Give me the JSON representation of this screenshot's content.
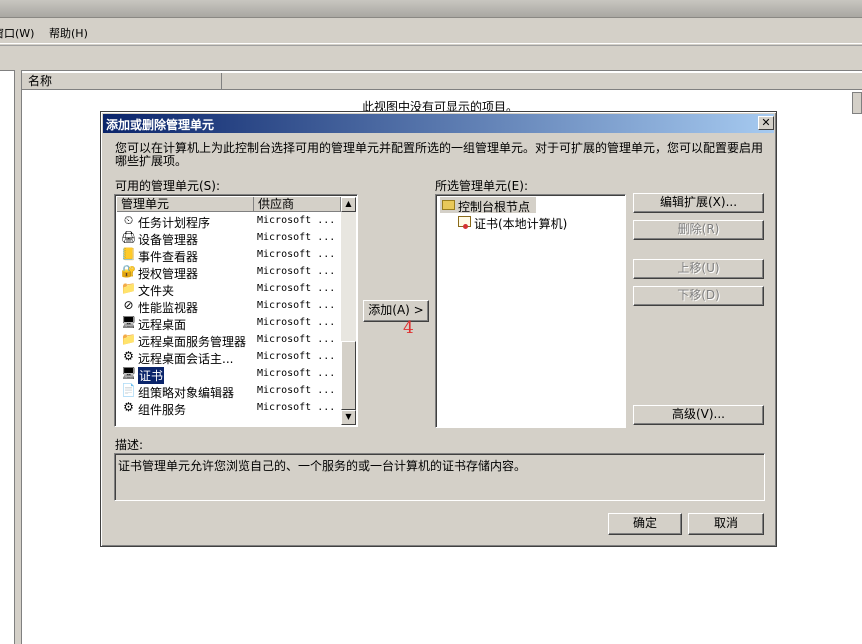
{
  "app": {
    "menu": [
      {
        "label": "窗口(W)"
      },
      {
        "label": "帮助(H)"
      }
    ],
    "list_column_name": "名称",
    "empty_message": "此视图中没有可显示的项目。"
  },
  "dialog": {
    "title": "添加或删除管理单元",
    "close_glyph": "✕",
    "intro": "您可以在计算机上为此控制台选择可用的管理单元并配置所选的一组管理单元。对于可扩展的管理单元，您可以配置要启用哪些扩展项。",
    "available_label": "可用的管理单元(S):",
    "available_columns": {
      "name": "管理单元",
      "vendor": "供应商"
    },
    "available_items": [
      {
        "name": "任务计划程序",
        "vendor": "Microsoft ...",
        "icon": "⏲",
        "icon_name": "clock-icon"
      },
      {
        "name": "设备管理器",
        "vendor": "Microsoft ...",
        "icon": "🖨",
        "icon_name": "device-manager-icon"
      },
      {
        "name": "事件查看器",
        "vendor": "Microsoft ...",
        "icon": "📒",
        "icon_name": "event-viewer-icon"
      },
      {
        "name": "授权管理器",
        "vendor": "Microsoft ...",
        "icon": "🔐",
        "icon_name": "authorization-icon"
      },
      {
        "name": "文件夹",
        "vendor": "Microsoft ...",
        "icon": "📁",
        "icon_name": "folder-icon"
      },
      {
        "name": "性能监视器",
        "vendor": "Microsoft ...",
        "icon": "⊘",
        "icon_name": "performance-monitor-icon"
      },
      {
        "name": "远程桌面",
        "vendor": "Microsoft ...",
        "icon": "🖥",
        "icon_name": "remote-desktop-icon"
      },
      {
        "name": "远程桌面服务管理器",
        "vendor": "Microsoft ...",
        "icon": "📁",
        "icon_name": "folder-icon"
      },
      {
        "name": "远程桌面会话主...",
        "vendor": "Microsoft ...",
        "icon": "⚙",
        "icon_name": "session-host-icon"
      },
      {
        "name": "证书",
        "vendor": "Microsoft ...",
        "icon": "🖥",
        "icon_name": "certificate-icon",
        "selected": true
      },
      {
        "name": "组策略对象编辑器",
        "vendor": "Microsoft ...",
        "icon": "📄",
        "icon_name": "gpo-editor-icon"
      },
      {
        "name": "组件服务",
        "vendor": "Microsoft ...",
        "icon": "⚙",
        "icon_name": "component-services-icon"
      }
    ],
    "add_button": "添加(A) >",
    "step_marker": "4",
    "selected_label": "所选管理单元(E):",
    "selected_tree": {
      "root": "控制台根节点",
      "child": "证书(本地计算机)"
    },
    "right_buttons": {
      "edit_ext": "编辑扩展(X)...",
      "remove": "删除(R)",
      "move_up": "上移(U)",
      "move_down": "下移(D)",
      "advanced": "高级(V)..."
    },
    "description_label": "描述:",
    "description": "证书管理单元允许您浏览自己的、一个服务的或一台计算机的证书存储内容。",
    "ok": "确定",
    "cancel": "取消"
  }
}
